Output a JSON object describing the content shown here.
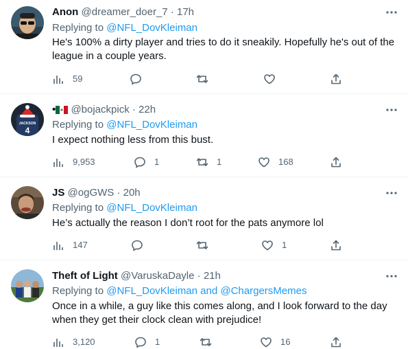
{
  "tweets": [
    {
      "name": "Anon",
      "handle": "@dreamer_doer_7",
      "time": "17h",
      "replying_prefix": "Replying to",
      "replying_to": "@NFL_DovKleiman",
      "text": "He's 100% a dirty player and tries to do it sneakily. Hopefully he's out of the league in a couple years.",
      "views": "59",
      "replies": "",
      "retweets": "",
      "likes": ""
    },
    {
      "name": "•",
      "handle": "@bojackpick",
      "time": "22h",
      "replying_prefix": "Replying to",
      "replying_to": "@NFL_DovKleiman",
      "text": "I expect nothing less from this bust.",
      "views": "9,953",
      "replies": "1",
      "retweets": "1",
      "likes": "168"
    },
    {
      "name": "JS",
      "handle": "@ogGWS",
      "time": "20h",
      "replying_prefix": "Replying to",
      "replying_to": "@NFL_DovKleiman",
      "text": "He’s actually the reason I don’t root for the pats anymore lol",
      "views": "147",
      "replies": "",
      "retweets": "",
      "likes": "1"
    },
    {
      "name": "Theft of Light",
      "handle": "@VaruskaDayle",
      "time": "21h",
      "replying_prefix": "Replying to",
      "replying_to": "@NFL_DovKleiman",
      "replying_and": "and",
      "replying_to_2": "@ChargersMemes",
      "text": "Once in a while, a guy like this comes along, and I look forward to the day when they get their clock clean with prejudice!",
      "views": "3,120",
      "replies": "1",
      "retweets": "",
      "likes": "16"
    }
  ],
  "separator": "·",
  "avatar2_jersey": "JACKSON",
  "avatar2_number": "4",
  "colors": {
    "link": "#1d9bf0",
    "muted": "#536471",
    "text": "#0f1419",
    "border": "#eff3f4"
  }
}
